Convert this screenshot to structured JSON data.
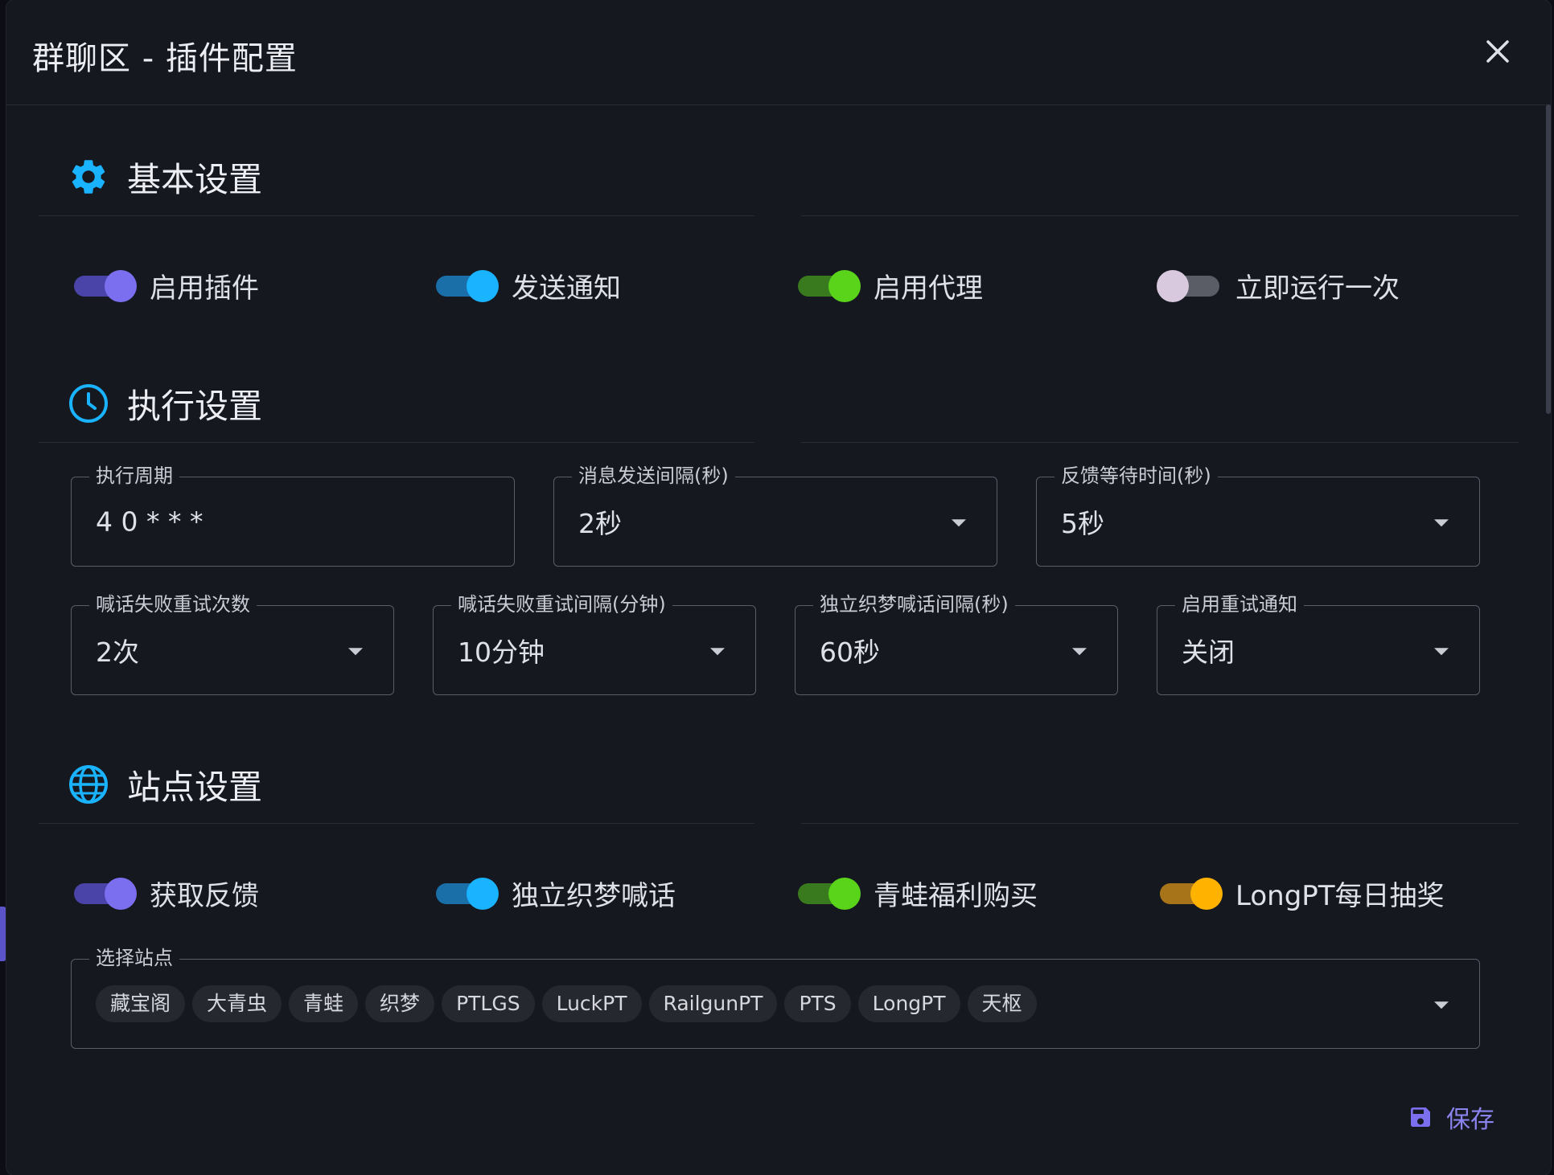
{
  "dialog": {
    "title": "群聊区 - 插件配置",
    "close_icon": "close-icon",
    "save_label": "保存",
    "save_icon": "floppy-disk-icon"
  },
  "sections": {
    "basic": {
      "title": "基本设置",
      "icon": "gear-icon",
      "switches": [
        {
          "label": "启用插件",
          "on": true,
          "color": "#7b6ff0",
          "track": "#4a44a8"
        },
        {
          "label": "发送通知",
          "on": true,
          "color": "#1ab3ff",
          "track": "#1a6fa8"
        },
        {
          "label": "启用代理",
          "on": true,
          "color": "#5ad41a",
          "track": "#3a7a1e"
        },
        {
          "label": "立即运行一次",
          "on": false,
          "color": "#d8c9df",
          "track": "#5a5c66"
        }
      ]
    },
    "execution": {
      "title": "执行设置",
      "icon": "clock-icon",
      "fields_row1": [
        {
          "label": "执行周期",
          "value": "4 0 * * *",
          "type": "text"
        },
        {
          "label": "消息发送间隔(秒)",
          "value": "2秒",
          "type": "select"
        },
        {
          "label": "反馈等待时间(秒)",
          "value": "5秒",
          "type": "select"
        }
      ],
      "fields_row2": [
        {
          "label": "喊话失败重试次数",
          "value": "2次",
          "type": "select"
        },
        {
          "label": "喊话失败重试间隔(分钟)",
          "value": "10分钟",
          "type": "select"
        },
        {
          "label": "独立织梦喊话间隔(秒)",
          "value": "60秒",
          "type": "select"
        },
        {
          "label": "启用重试通知",
          "value": "关闭",
          "type": "select"
        }
      ]
    },
    "sites": {
      "title": "站点设置",
      "icon": "globe-icon",
      "switches": [
        {
          "label": "获取反馈",
          "on": true,
          "color": "#7b6ff0",
          "track": "#4a44a8"
        },
        {
          "label": "独立织梦喊话",
          "on": true,
          "color": "#1ab3ff",
          "track": "#1a6fa8"
        },
        {
          "label": "青蛙福利购买",
          "on": true,
          "color": "#5ad41a",
          "track": "#3a7a1e"
        },
        {
          "label": "LongPT每日抽奖",
          "on": true,
          "color": "#ffb300",
          "track": "#a8741a"
        }
      ],
      "site_select": {
        "label": "选择站点",
        "chips": [
          "藏宝阁",
          "大青虫",
          "青蛙",
          "织梦",
          "PTLGS",
          "LuckPT",
          "RailgunPT",
          "PTS",
          "LongPT",
          "天枢"
        ]
      }
    }
  }
}
